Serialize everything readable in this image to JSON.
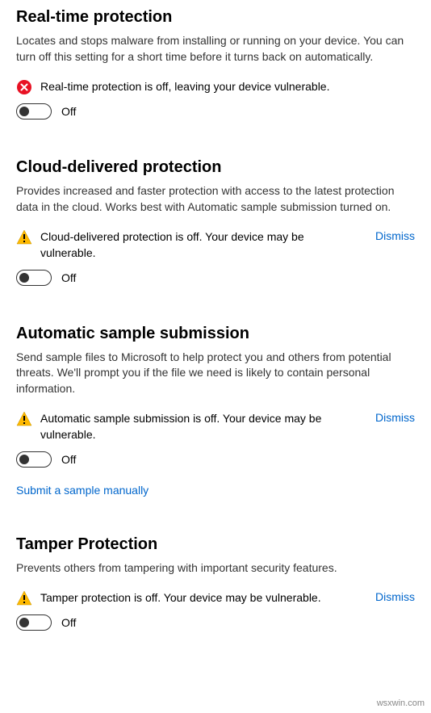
{
  "sections": {
    "realtime": {
      "title": "Real-time protection",
      "desc": "Locates and stops malware from installing or running on your device. You can turn off this setting for a short time before it turns back on automatically.",
      "status": "Real-time protection is off, leaving your device vulnerable.",
      "toggle_label": "Off"
    },
    "cloud": {
      "title": "Cloud-delivered protection",
      "desc": "Provides increased and faster protection with access to the latest protection data in the cloud. Works best with Automatic sample submission turned on.",
      "status": "Cloud-delivered protection is off. Your device may be vulnerable.",
      "dismiss": "Dismiss",
      "toggle_label": "Off"
    },
    "sample": {
      "title": "Automatic sample submission",
      "desc": "Send sample files to Microsoft to help protect you and others from potential threats. We'll prompt you if the file we need is likely to contain personal information.",
      "status": "Automatic sample submission is off. Your device may be vulnerable.",
      "dismiss": "Dismiss",
      "toggle_label": "Off",
      "link": "Submit a sample manually"
    },
    "tamper": {
      "title": "Tamper Protection",
      "desc": "Prevents others from tampering with important security features.",
      "status": "Tamper protection is off. Your device may be vulnerable.",
      "dismiss": "Dismiss",
      "toggle_label": "Off"
    }
  },
  "watermark": "wsxwin.com"
}
